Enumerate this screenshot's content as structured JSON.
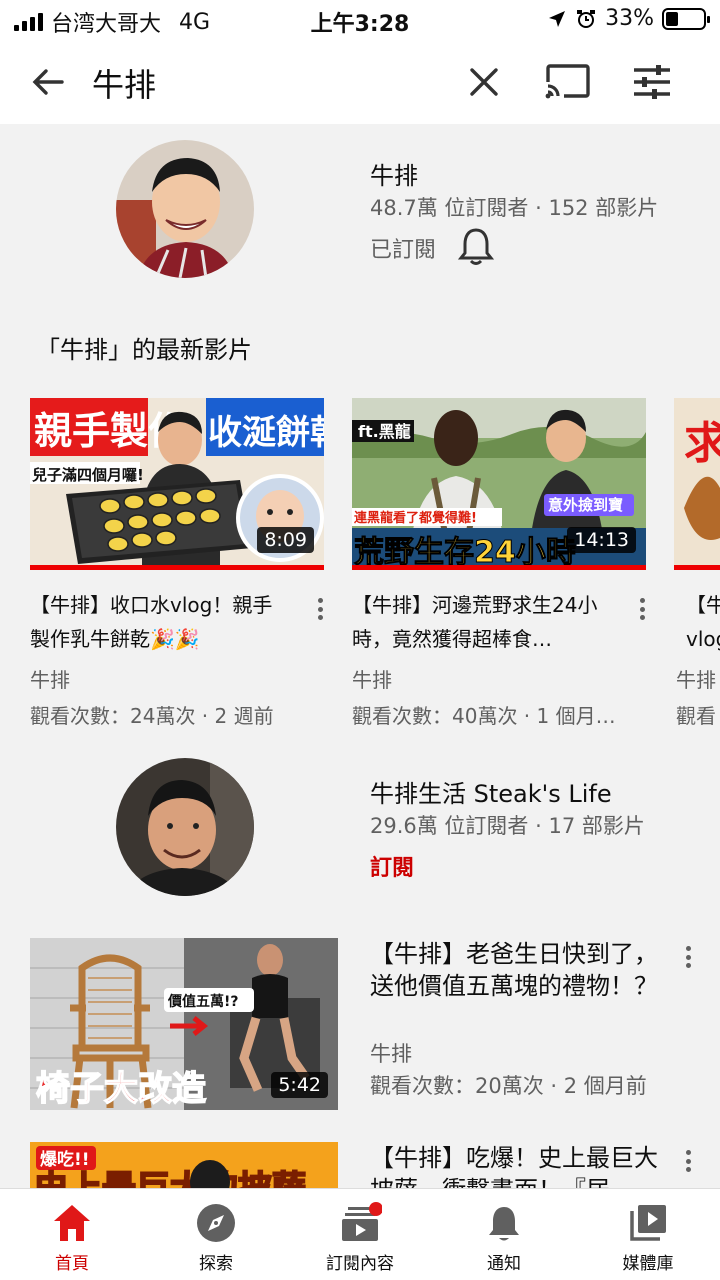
{
  "status_bar": {
    "carrier": "台湾大哥大",
    "network": "4G",
    "time": "上午3:28",
    "battery": "33%",
    "battery_level": 0.33
  },
  "search": {
    "query": "牛排"
  },
  "channel1": {
    "name": "牛排",
    "meta": "48.7萬 位訂閱者 · 152 部影片",
    "subscribed_label": "已訂閱"
  },
  "section": {
    "title": "「牛排」的最新影片"
  },
  "carousel": [
    {
      "title": "【牛排】收口水vlog！親手製作乳牛餅乾🎉🎉",
      "channel": "牛排",
      "meta": "觀看次數：24萬次 · 2 週前",
      "duration": "8:09",
      "thumb_text": [
        "親手製作",
        "收涎餅乾",
        "兒子滿四個月囉!"
      ]
    },
    {
      "title": "【牛排】河邊荒野求生24小時，竟然獲得超棒食…",
      "channel": "牛排",
      "meta": "觀看次數：40萬次 · 1 個月…",
      "duration": "14:13",
      "thumb_text": [
        "ft.黑龍",
        "連黑龍看了都覺得難!",
        "意外撿到寶",
        "荒野生存24小時"
      ]
    },
    {
      "title": "【牛",
      "title2": "vlog",
      "channel": "牛排",
      "meta": "觀看",
      "thumb_text": [
        "求"
      ]
    }
  ],
  "channel2": {
    "name": "牛排生活 Steak's Life",
    "meta": "29.6萬 位訂閱者 · 17 部影片",
    "subscribe_label": "訂閱"
  },
  "videos": [
    {
      "title": "【牛排】老爸生日快到了，送他價值五萬塊的禮物！？",
      "channel": "牛排",
      "meta": "觀看次數：20萬次 · 2 個月前",
      "duration": "5:42",
      "thumb_text": [
        "價值五萬!?",
        "椅子大改造"
      ]
    },
    {
      "title": "【牛排】吃爆！史上最巨大披薩，衝擊畫面！『居",
      "thumb_text": [
        "爆吃!!",
        "史上最巨大的披薩"
      ]
    }
  ],
  "bottom_nav": [
    {
      "label": "首頁",
      "icon": "home-icon"
    },
    {
      "label": "探索",
      "icon": "explore-icon"
    },
    {
      "label": "訂閱內容",
      "icon": "subscriptions-icon"
    },
    {
      "label": "通知",
      "icon": "bell-icon"
    },
    {
      "label": "媒體庫",
      "icon": "library-icon"
    }
  ],
  "colors": {
    "accent": "#cc0000",
    "background": "#f2f2f2",
    "progress_red": "#ee0000"
  }
}
